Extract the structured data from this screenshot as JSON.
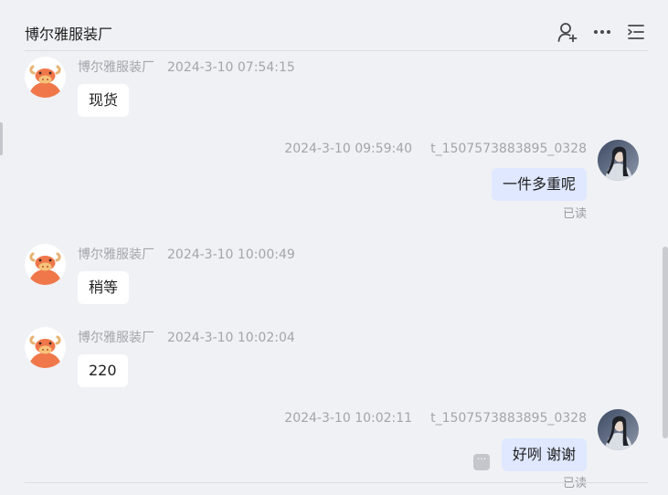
{
  "header": {
    "title": "博尔雅服装厂",
    "icons": [
      "add-person-icon",
      "more-dots-icon",
      "menu-list-icon"
    ]
  },
  "messages": [
    {
      "sender": "博尔雅服装厂",
      "time": "2024-3-10 07:54:15",
      "text": "现货",
      "direction": "incoming"
    },
    {
      "sender": "t_1507573883895_0328",
      "time": "2024-3-10 09:59:40",
      "text": "一件多重呢",
      "direction": "outgoing",
      "status": "已读"
    },
    {
      "sender": "博尔雅服装厂",
      "time": "2024-3-10 10:00:49",
      "text": "稍等",
      "direction": "incoming"
    },
    {
      "sender": "博尔雅服装厂",
      "time": "2024-3-10 10:02:04",
      "text": "220",
      "direction": "incoming"
    },
    {
      "sender": "t_1507573883895_0328",
      "time": "2024-3-10 10:02:11",
      "text": "好咧 谢谢",
      "direction": "outgoing",
      "status": "已读"
    }
  ],
  "colors": {
    "background": "#f0f1f5",
    "incoming_bubble": "#ffffff",
    "outgoing_bubble": "#dfe8ff",
    "meta_text": "#a3a5ab",
    "avatar_bull": "#f0774a"
  }
}
